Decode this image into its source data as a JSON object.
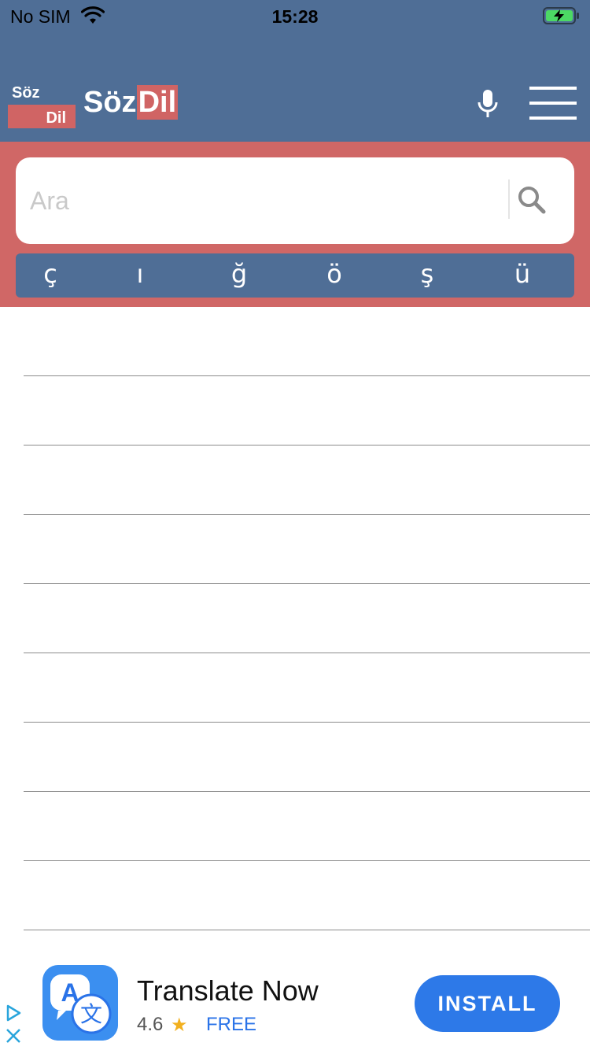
{
  "status_bar": {
    "carrier": "No SIM",
    "time": "15:28"
  },
  "header": {
    "logo_top": "Söz",
    "logo_bottom": "Dil",
    "brand_primary": "Söz",
    "brand_accent": "Dil",
    "icons": [
      "mic-icon",
      "menu-icon"
    ]
  },
  "search": {
    "placeholder": "Ara",
    "value": ""
  },
  "special_chars": [
    "ç",
    "ı",
    "ğ",
    "ö",
    "ş",
    "ü"
  ],
  "results": [
    "",
    "",
    "",
    "",
    "",
    "",
    "",
    "",
    ""
  ],
  "ad": {
    "title": "Translate Now",
    "rating": "4.6",
    "price": "FREE",
    "install_label": "INSTALL"
  },
  "colors": {
    "header_bg": "#4f6e96",
    "accent_red": "#d06766",
    "install_blue": "#2d79e8"
  }
}
